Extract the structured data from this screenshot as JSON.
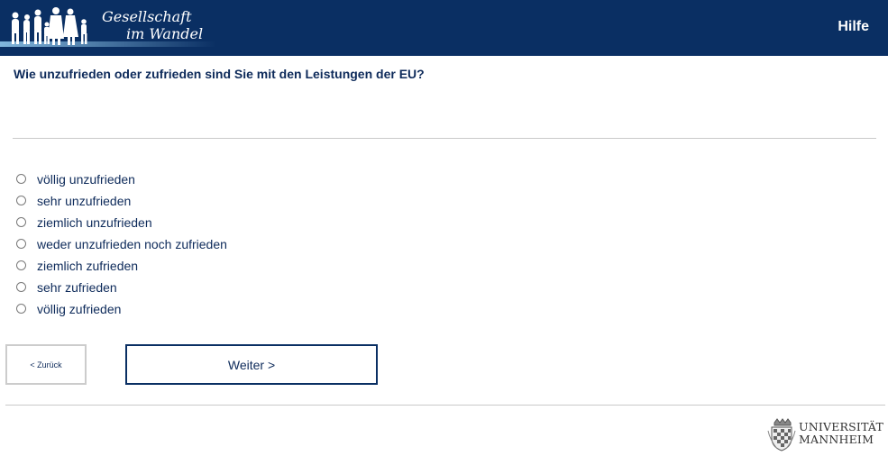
{
  "header": {
    "logo_line1": "Gesellschaft",
    "logo_line2": "im Wandel",
    "help_label": "Hilfe"
  },
  "question": "Wie unzufrieden oder zufrieden sind Sie mit den Leistungen der EU?",
  "options": [
    {
      "label": "völlig unzufrieden"
    },
    {
      "label": "sehr unzufrieden"
    },
    {
      "label": "ziemlich unzufrieden"
    },
    {
      "label": "weder unzufrieden noch zufrieden"
    },
    {
      "label": "ziemlich zufrieden"
    },
    {
      "label": "sehr zufrieden"
    },
    {
      "label": "völlig zufrieden"
    }
  ],
  "nav": {
    "back_label": "< Zurück",
    "next_label": "Weiter >"
  },
  "footer": {
    "uni_line1": "UNIVERSITÄT",
    "uni_line2": "MANNHEIM"
  },
  "colors": {
    "header_bg": "#0a2f63",
    "text": "#0d2a5a"
  }
}
